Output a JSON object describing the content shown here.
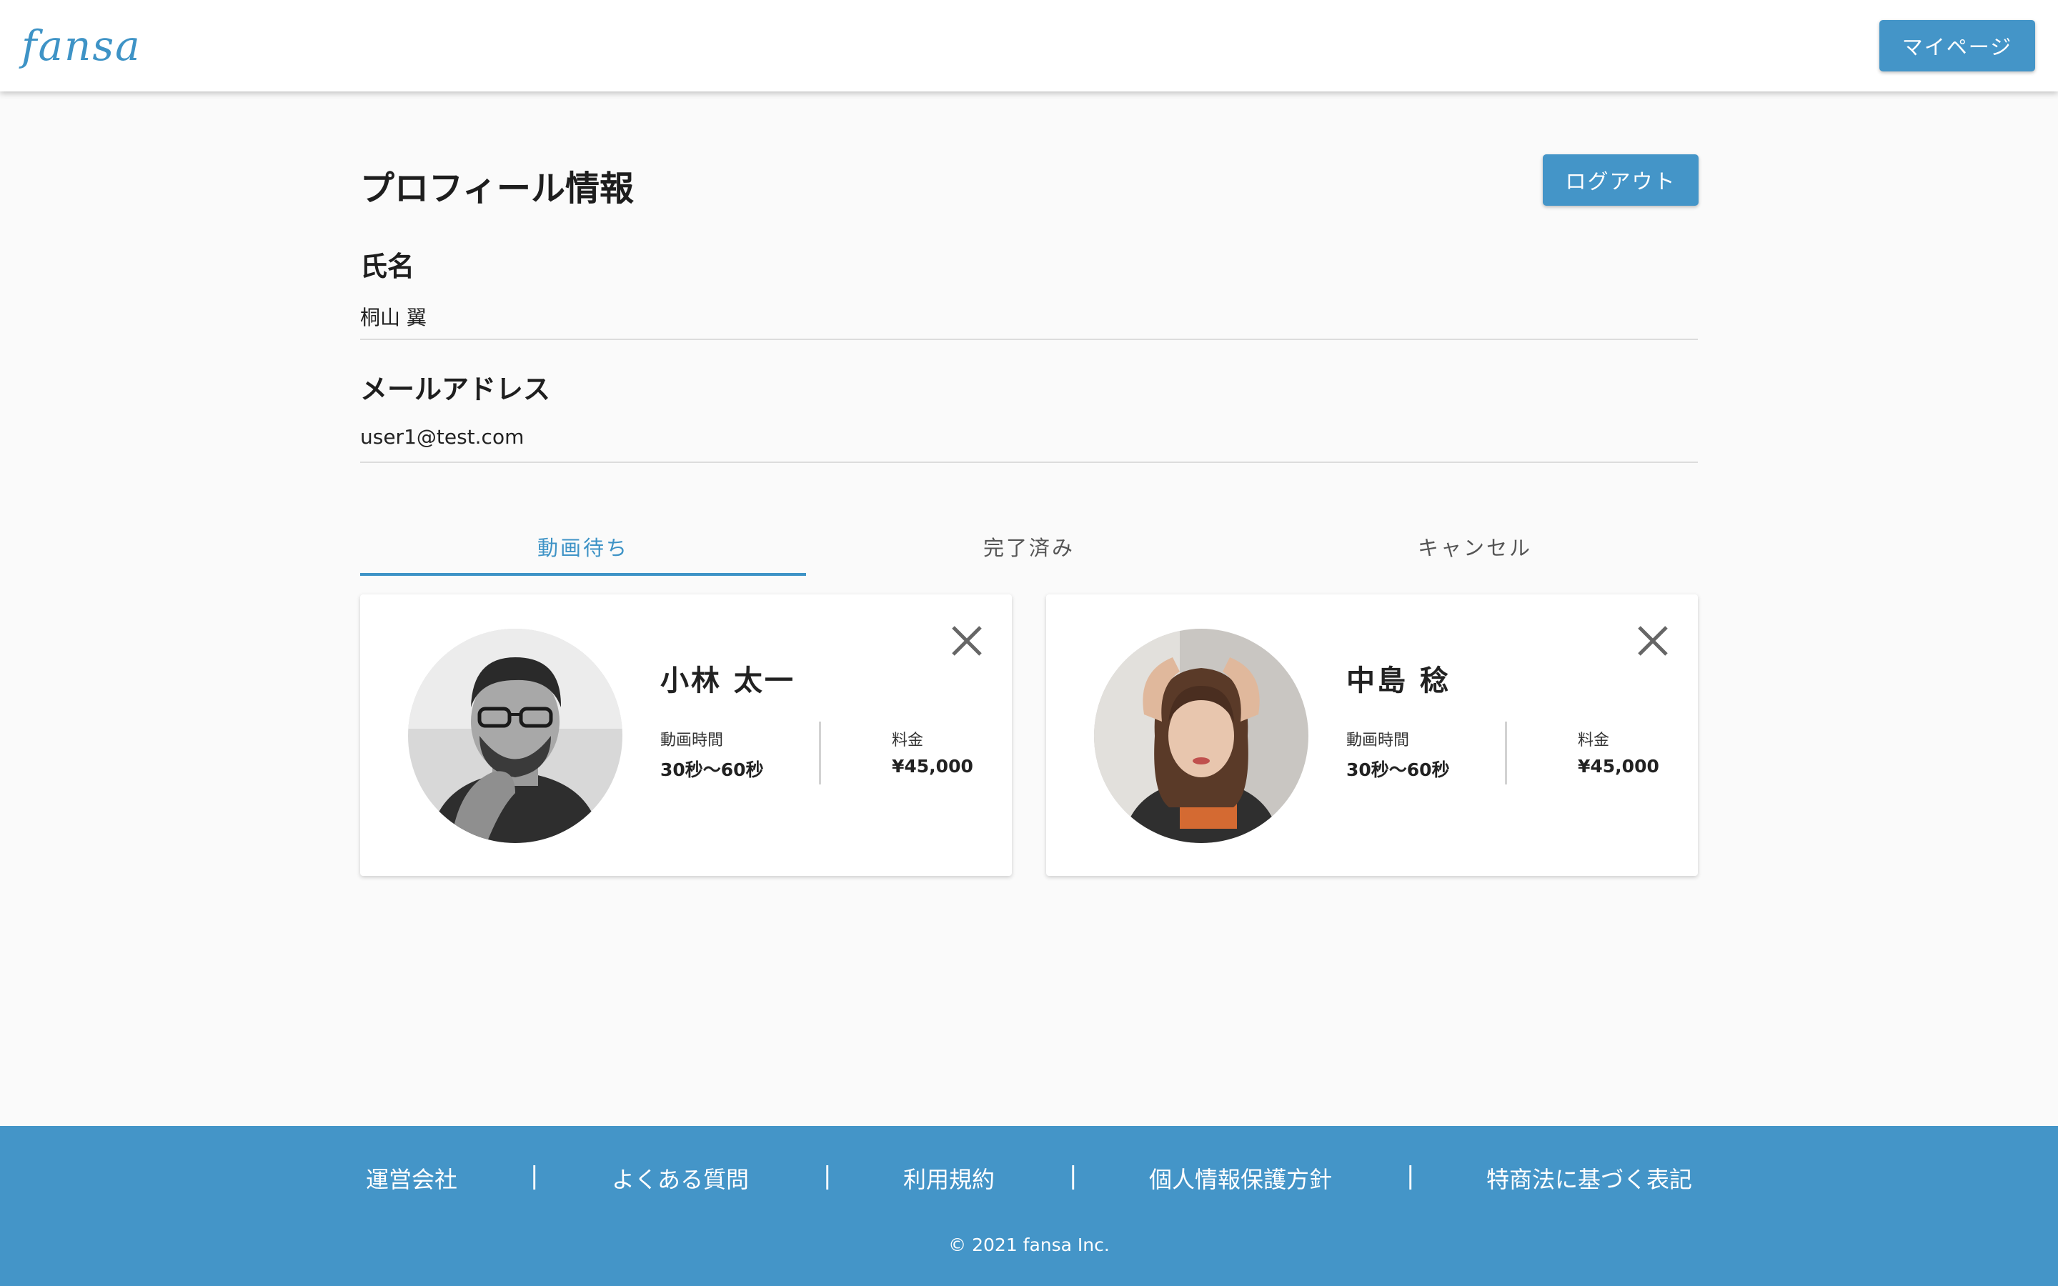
{
  "header": {
    "logo": "fansa",
    "mypage_label": "マイページ"
  },
  "profile": {
    "title": "プロフィール情報",
    "logout_label": "ログアウト",
    "name_label": "氏名",
    "name_value": "桐山 翼",
    "email_label": "メールアドレス",
    "email_value": "user1@test.com"
  },
  "tabs": [
    {
      "label": "動画待ち",
      "active": true
    },
    {
      "label": "完了済み",
      "active": false
    },
    {
      "label": "キャンセル",
      "active": false
    }
  ],
  "cards": [
    {
      "name": "小林 太一",
      "duration_label": "動画時間",
      "duration_value": "30秒〜60秒",
      "price_label": "料金",
      "price_value": "¥45,000",
      "icon": "close-icon"
    },
    {
      "name": "中島 稔",
      "duration_label": "動画時間",
      "duration_value": "30秒〜60秒",
      "price_label": "料金",
      "price_value": "¥45,000",
      "icon": "close-icon"
    }
  ],
  "footer": {
    "links": [
      "運営会社",
      "よくある質問",
      "利用規約",
      "個人情報保護方針",
      "特商法に基づく表記"
    ],
    "separator": "|",
    "copyright": "© 2021 fansa Inc."
  },
  "colors": {
    "accent": "#4495c8",
    "background": "#fafafa",
    "footer": "#4495c8"
  }
}
